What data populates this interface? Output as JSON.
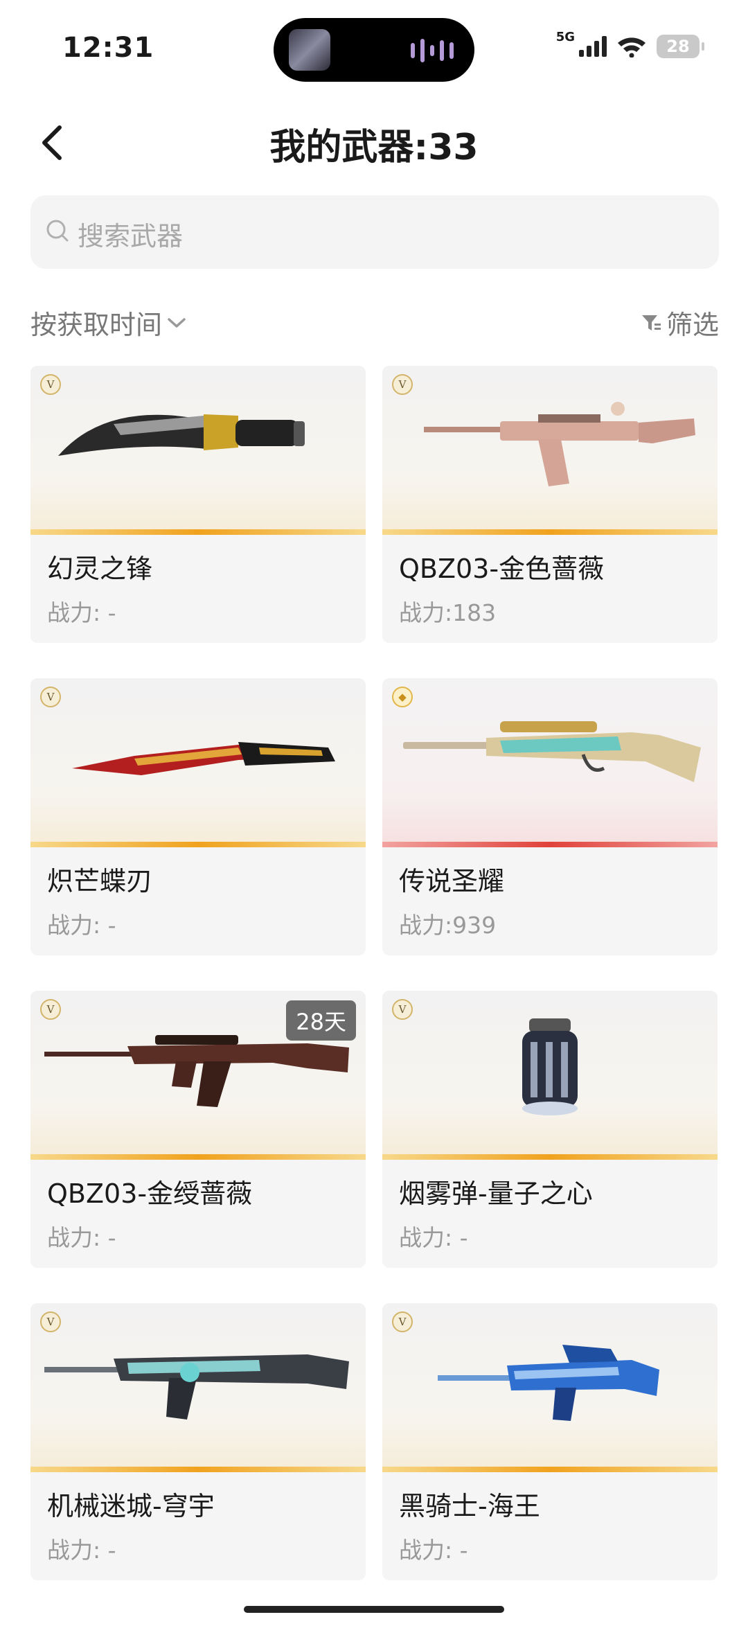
{
  "status": {
    "time": "12:31",
    "network": "5G",
    "battery": "28"
  },
  "header": {
    "title": "我的武器:33"
  },
  "search": {
    "placeholder": "搜索武器"
  },
  "toolbar": {
    "sort_label": "按获取时间",
    "filter_label": "筛选"
  },
  "weapons": [
    {
      "name": "幻灵之锋",
      "power": "战力: -",
      "badge": "V",
      "rarity": "gold"
    },
    {
      "name": "QBZ03-金色蔷薇",
      "power": "战力:183",
      "badge": "V",
      "rarity": "gold"
    },
    {
      "name": "炽芒蝶刃",
      "power": "战力: -",
      "badge": "V",
      "rarity": "gold"
    },
    {
      "name": "传说圣耀",
      "power": "战力:939",
      "badge": "diamond",
      "rarity": "red"
    },
    {
      "name": "QBZ03-金绶蔷薇",
      "power": "战力: -",
      "badge": "V",
      "rarity": "gold",
      "days": "28天"
    },
    {
      "name": "烟雾弹-量子之心",
      "power": "战力: -",
      "badge": "V",
      "rarity": "gold"
    },
    {
      "name": "机械迷城-穹宇",
      "power": "战力: -",
      "badge": "V",
      "rarity": "gold"
    },
    {
      "name": "黑骑士-海王",
      "power": "战力: -",
      "badge": "V",
      "rarity": "gold"
    }
  ],
  "colors": {
    "accent_gold": "#f0a21e",
    "accent_red": "#e0423a",
    "card_bg": "#f5f5f5",
    "muted_text": "#999999"
  }
}
